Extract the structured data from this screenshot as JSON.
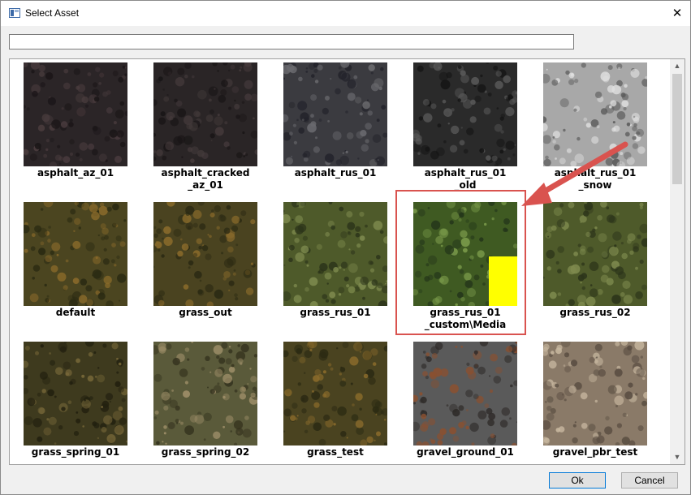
{
  "window": {
    "title": "Select Asset",
    "close_glyph": "✕"
  },
  "search": {
    "value": ""
  },
  "assets": [
    {
      "label_lines": [
        "asphalt_az_01"
      ],
      "colors": [
        "#2b2527",
        "#4a3c3e",
        "#1b1618"
      ]
    },
    {
      "label_lines": [
        "asphalt_cracked",
        "_az_01"
      ],
      "colors": [
        "#2a2526",
        "#443a3b",
        "#191516"
      ]
    },
    {
      "label_lines": [
        "asphalt_rus_01"
      ],
      "colors": [
        "#3b3b40",
        "#6a6a6e",
        "#22222a"
      ]
    },
    {
      "label_lines": [
        "asphalt_rus_01",
        "_old"
      ],
      "colors": [
        "#2a2a2a",
        "#5a5a5a",
        "#141414"
      ]
    },
    {
      "label_lines": [
        "asphalt_rus_01",
        "_snow"
      ],
      "colors": [
        "#a8a8a8",
        "#e0e0e0",
        "#5a5a5a"
      ]
    },
    {
      "label_lines": [
        "default"
      ],
      "colors": [
        "#4b4520",
        "#8a6a2a",
        "#2a2a12"
      ]
    },
    {
      "label_lines": [
        "grass_out"
      ],
      "colors": [
        "#4a4320",
        "#8a6b2b",
        "#2b2a13"
      ]
    },
    {
      "label_lines": [
        "grass_rus_01"
      ],
      "colors": [
        "#4e5a2a",
        "#7e8a4e",
        "#2c341a"
      ]
    },
    {
      "label_lines": [
        "grass_rus_01",
        "_custom\\Media"
      ],
      "colors": [
        "#3f5a22",
        "#7a9a4a",
        "#24361a"
      ]
    },
    {
      "label_lines": [
        "grass_rus_02"
      ],
      "colors": [
        "#4e5a2a",
        "#7e8a4e",
        "#2c341a"
      ]
    },
    {
      "label_lines": [
        "grass_spring_01"
      ],
      "colors": [
        "#3e3a1e",
        "#7a6a3a",
        "#22200f"
      ]
    },
    {
      "label_lines": [
        "grass_spring_02"
      ],
      "colors": [
        "#5a5a3a",
        "#a0906a",
        "#34321e"
      ]
    },
    {
      "label_lines": [
        "grass_test"
      ],
      "colors": [
        "#4a4320",
        "#8a6b2b",
        "#2b2a13"
      ]
    },
    {
      "label_lines": [
        "gravel_ground_01"
      ],
      "colors": [
        "#5a5a5a",
        "#8a5030",
        "#2e2a28"
      ]
    },
    {
      "label_lines": [
        "gravel_pbr_test"
      ],
      "colors": [
        "#8a7a68",
        "#c8b8a0",
        "#5a4e42"
      ]
    }
  ],
  "scrollbar": {
    "up_glyph": "▲",
    "down_glyph": "▼"
  },
  "buttons": {
    "ok": "Ok",
    "cancel": "Cancel"
  },
  "annotation": {
    "color": "#d9534f"
  }
}
